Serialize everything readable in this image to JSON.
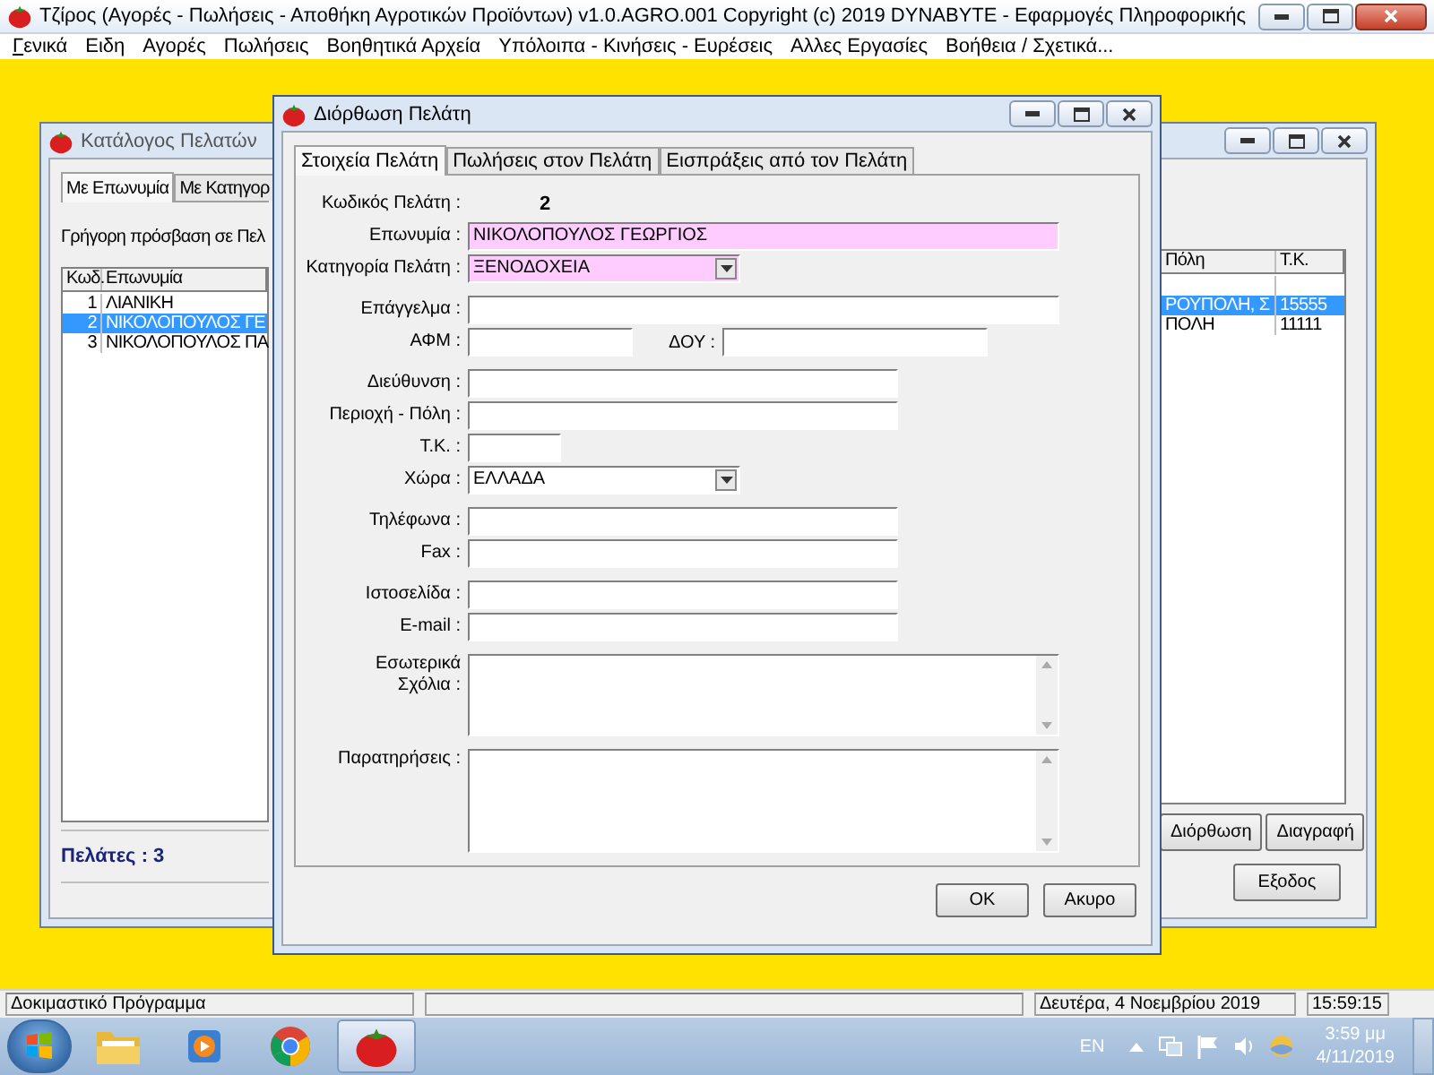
{
  "main_window": {
    "title": "Τζίρος (Αγορές - Πωλήσεις - Αποθήκη Αγροτικών Προϊόντων)  v1.0.AGRO.001  Copyright (c) 2019  DYNABYTE - Εφαρμογές Πληροφορικής"
  },
  "menu": [
    {
      "label": "Γενικά",
      "underline_first": true
    },
    {
      "label": "Ειδη",
      "underline_first": false
    },
    {
      "label": "Αγορές",
      "underline_first": false
    },
    {
      "label": "Πωλήσεις",
      "underline_first": false
    },
    {
      "label": "Βοηθητικά Αρχεία",
      "underline_first": false
    },
    {
      "label": "Υπόλοιπα - Κινήσεις - Ευρέσεις",
      "underline_first": false
    },
    {
      "label": "Αλλες Εργασίες",
      "underline_first": false
    },
    {
      "label": "Βοήθεια / Σχετικά...",
      "underline_first": false
    }
  ],
  "customer_list_window": {
    "title": "Κατάλογος Πελατών",
    "tabs": [
      {
        "label": "Με Επωνυμία",
        "selected": true
      },
      {
        "label": "Με Κατηγορ",
        "selected": false
      }
    ],
    "quick_access_label": "Γρήγορη πρόσβαση σε Πελ",
    "table": {
      "columns": [
        "Κωδ.",
        "Επωνυμία",
        "Πόλη",
        "Τ.Κ."
      ],
      "rows": [
        {
          "code": "1",
          "name": "ΛΙΑΝΙΚΗ",
          "selected": false
        },
        {
          "code": "2",
          "name": "ΝΙΚΟΛΟΠΟΥΛΟΣ ΓΕ",
          "city": "ΡΟΥΠΟΛΗ, Σ",
          "postal_code": "15555",
          "selected": true
        },
        {
          "code": "3",
          "name": "ΝΙΚΟΛΟΠΟΥΛΟΣ ΠΑ",
          "city": "ΠΟΛΗ",
          "postal_code": "11111",
          "selected": false
        }
      ]
    },
    "count_label": "Πελάτες : 3",
    "buttons": [
      "Διόρθωση",
      "Διαγραφή"
    ],
    "exit_button": "Εξοδος"
  },
  "edit_dialog": {
    "title": "Διόρθωση Πελάτη",
    "tabs": [
      {
        "label": "Στοιχεία Πελάτη",
        "selected": true
      },
      {
        "label": "Πωλήσεις στον Πελάτη",
        "selected": false
      },
      {
        "label": "Εισπράξεις από τον Πελάτη",
        "selected": false
      }
    ],
    "form_groups": [
      [
        {
          "kind": "value",
          "label": "Κωδικός Πελάτη :",
          "value": "2"
        },
        {
          "kind": "text",
          "label": "Επωνυμία :",
          "value": "ΝΙΚΟΛΟΠΟΥΛΟΣ ΓΕΩΡΓΙΟΣ",
          "required": true
        },
        {
          "kind": "combo",
          "label": "Κατηγορία Πελάτη :",
          "value": "ΞΕΝΟΔΟΧΕΙΑ",
          "required": true
        }
      ],
      [
        {
          "kind": "text",
          "label": "Επάγγελμα :",
          "required": false
        },
        {
          "kind": "pair",
          "label": "ΑΦΜ :",
          "second_label": "ΔΟΥ :"
        }
      ],
      [
        {
          "kind": "text",
          "label": "Διεύθυνση :",
          "required": false
        },
        {
          "kind": "text",
          "label": "Περιοχή - Πόλη :",
          "required": false
        },
        {
          "kind": "text",
          "label": "Τ.Κ. :",
          "required": false
        },
        {
          "kind": "combo",
          "label": "Χώρα :",
          "value": "ΕΛΛΑΔΑ",
          "required": false
        }
      ],
      [
        {
          "kind": "text",
          "label": "Τηλέφωνα :",
          "required": false
        },
        {
          "kind": "text",
          "label": "Fax :",
          "required": false
        }
      ],
      [
        {
          "kind": "text",
          "label": "Ιστοσελίδα :",
          "required": false
        },
        {
          "kind": "text",
          "label": "E-mail :",
          "required": false
        }
      ],
      [
        {
          "kind": "memo",
          "label": "Εσωτερικά\nΣχόλια :"
        }
      ],
      [
        {
          "kind": "memo",
          "label": "Παρατηρήσεις :"
        }
      ]
    ],
    "buttons": [
      "OK",
      "Ακυρο"
    ]
  },
  "status_bar": {
    "message": "Δοκιμαστικό Πρόγραμμα",
    "date": "Δευτέρα, 4 Νοεμβρίου 2019",
    "time": "15:59:15"
  },
  "taskbar": {
    "apps": [
      {
        "kind": "folder",
        "active": false
      },
      {
        "kind": "media",
        "active": false
      },
      {
        "kind": "browser",
        "active": false
      },
      {
        "kind": "tomato",
        "active": true
      }
    ],
    "language": "EN",
    "clock_time": "3:59 μμ",
    "clock_date": "4/11/2019"
  }
}
